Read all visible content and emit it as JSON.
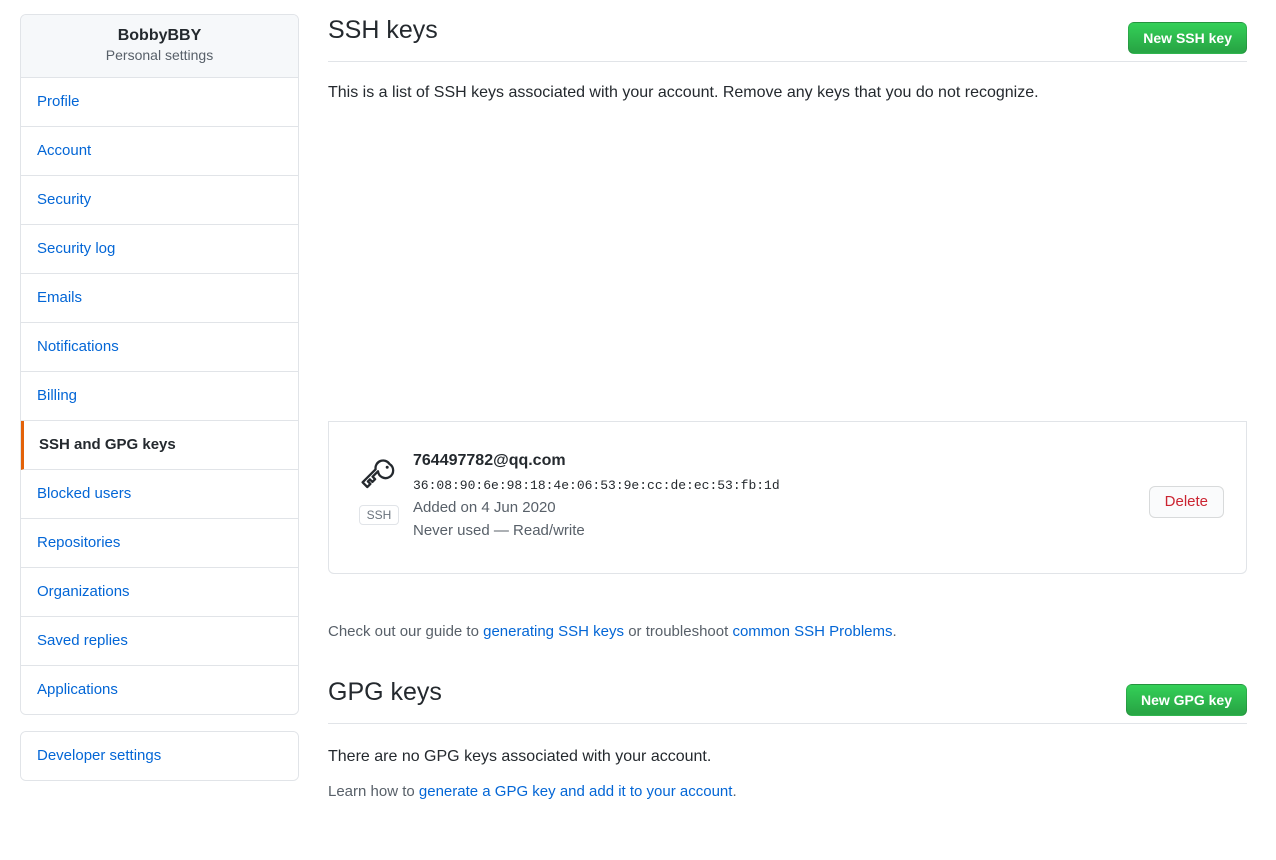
{
  "sidebar": {
    "header": {
      "username": "BobbyBBY",
      "subtitle": "Personal settings"
    },
    "items": [
      {
        "label": "Profile",
        "selected": false
      },
      {
        "label": "Account",
        "selected": false
      },
      {
        "label": "Security",
        "selected": false
      },
      {
        "label": "Security log",
        "selected": false
      },
      {
        "label": "Emails",
        "selected": false
      },
      {
        "label": "Notifications",
        "selected": false
      },
      {
        "label": "Billing",
        "selected": false
      },
      {
        "label": "SSH and GPG keys",
        "selected": true
      },
      {
        "label": "Blocked users",
        "selected": false
      },
      {
        "label": "Repositories",
        "selected": false
      },
      {
        "label": "Organizations",
        "selected": false
      },
      {
        "label": "Saved replies",
        "selected": false
      },
      {
        "label": "Applications",
        "selected": false
      }
    ],
    "secondary_items": [
      {
        "label": "Developer settings"
      }
    ]
  },
  "ssh_section": {
    "title": "SSH keys",
    "new_key_button": "New SSH key",
    "description": "This is a list of SSH keys associated with your account. Remove any keys that you do not recognize.",
    "keys": [
      {
        "badge": "SSH",
        "title": "764497782@qq.com",
        "fingerprint": "36:08:90:6e:98:18:4e:06:53:9e:cc:de:ec:53:fb:1d",
        "added": "Added on 4 Jun 2020",
        "usage": "Never used — Read/write",
        "delete_button": "Delete"
      }
    ],
    "footnote": {
      "prefix": "Check out our guide to ",
      "link1": "generating SSH keys",
      "middle": " or troubleshoot ",
      "link2": "common SSH Problems",
      "suffix": "."
    }
  },
  "gpg_section": {
    "title": "GPG keys",
    "new_key_button": "New GPG key",
    "empty_message": "There are no GPG keys associated with your account.",
    "learn": {
      "prefix": "Learn how to ",
      "link": "generate a GPG key and add it to your account",
      "suffix": "."
    }
  },
  "icons": {
    "key": "key-icon"
  },
  "colors": {
    "accent_selected": "#e36209",
    "link": "#0366d6",
    "green_button": "#28a745",
    "danger": "#cb2431",
    "border": "#e1e4e8",
    "muted_text": "#586069"
  }
}
